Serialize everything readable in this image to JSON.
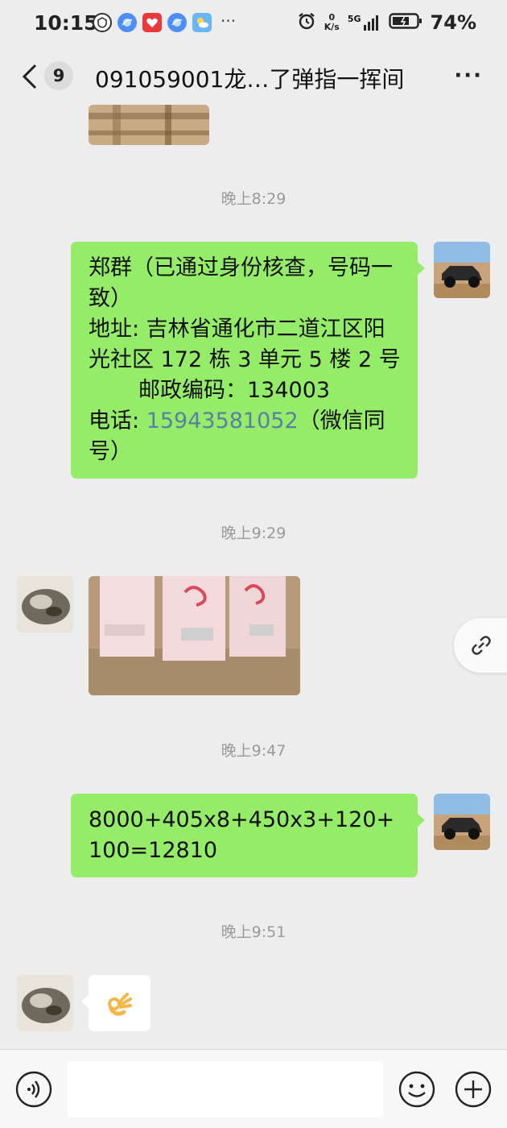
{
  "status_bar": {
    "time": "10:15",
    "app_icons": [
      "vpn-icon",
      "browser-icon",
      "app-icon",
      "browser-icon",
      "weather-icon"
    ],
    "more": "···",
    "speed_value": "0",
    "speed_unit": "K/s",
    "network": "5G",
    "battery": "74%"
  },
  "header": {
    "back_count": "9",
    "title": "091059001龙…了弹指一挥间",
    "menu": "···"
  },
  "messages": [
    {
      "type": "timestamp",
      "text": "晚上8:29"
    },
    {
      "type": "outgoing_text",
      "lines": {
        "line1": "郑群（已通过身份核查，号码一致）",
        "line2": "地址: 吉林省通化市二道江区阳光社区 172 栋 3 单元 5 楼 2 号",
        "line3": "邮政编码：134003",
        "line4_prefix": "电话: ",
        "line4_phone": "15943581052",
        "line4_suffix": "（微信同号）"
      }
    },
    {
      "type": "timestamp",
      "text": "晚上9:29"
    },
    {
      "type": "timestamp",
      "text": "晚上9:47"
    },
    {
      "type": "outgoing_text",
      "text": "8000+405x8+450x3+120+100=12810"
    },
    {
      "type": "timestamp",
      "text": "晚上9:51"
    }
  ],
  "colors": {
    "background": "#ededed",
    "outgoing_bubble": "#95ec69",
    "incoming_bubble": "#ffffff",
    "link": "#5a7fa3",
    "timestamp": "#9a9a9a"
  },
  "icons": {
    "voice": "voice-icon",
    "emoji": "emoji-icon",
    "plus": "plus-icon",
    "link": "link-icon",
    "ok_hand": "ok-hand-emoji"
  }
}
